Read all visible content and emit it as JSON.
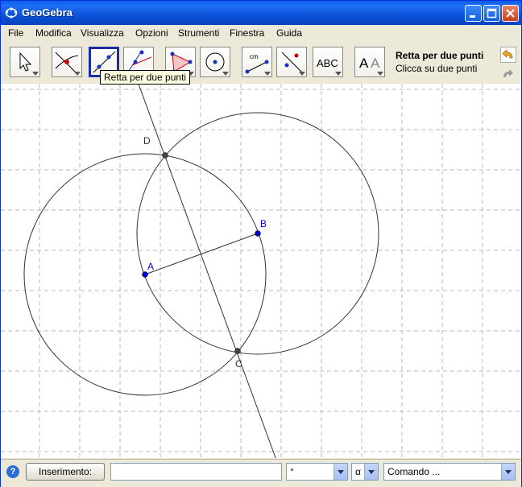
{
  "window": {
    "title": "GeoGebra"
  },
  "menu": {
    "items": [
      "File",
      "Modifica",
      "Visualizza",
      "Opzioni",
      "Strumenti",
      "Finestra",
      "Guida"
    ]
  },
  "toolbar": {
    "tools": [
      {
        "name": "move-tool",
        "icon": "cursor-arrow-icon"
      },
      {
        "name": "point-tool",
        "icon": "intersect-point-icon"
      },
      {
        "name": "line-tool",
        "icon": "line-through-two-points-icon",
        "selected": true
      },
      {
        "name": "perpendicular-tool",
        "icon": "perpendicular-line-icon"
      },
      {
        "name": "polygon-tool",
        "icon": "polygon-icon"
      },
      {
        "name": "circle-tool",
        "icon": "circle-center-point-icon"
      },
      {
        "name": "measure-tool",
        "icon": "distance-measure-icon"
      },
      {
        "name": "reflect-tool",
        "icon": "reflect-about-line-icon"
      },
      {
        "name": "text-tool",
        "icon": "text-abc-icon",
        "label": "ABC"
      },
      {
        "name": "slider-tool",
        "icon": "font-aa-icon",
        "label": "A A"
      }
    ],
    "active_tool_title": "Retta per due punti",
    "active_tool_hint": "Clicca su due punti",
    "tooltip": "Retta per due punti"
  },
  "graphics": {
    "points": [
      {
        "label": "A",
        "color": "#0000cc"
      },
      {
        "label": "B",
        "color": "#0000cc"
      },
      {
        "label": "C",
        "color": "#333333"
      },
      {
        "label": "D",
        "color": "#333333"
      }
    ],
    "grid": true,
    "object_color": "#333333"
  },
  "input_bar": {
    "label_button": "Inserimento:",
    "input_value": "",
    "degree_symbol": "°",
    "alpha_symbol": "α",
    "command_placeholder": "Comando ..."
  }
}
